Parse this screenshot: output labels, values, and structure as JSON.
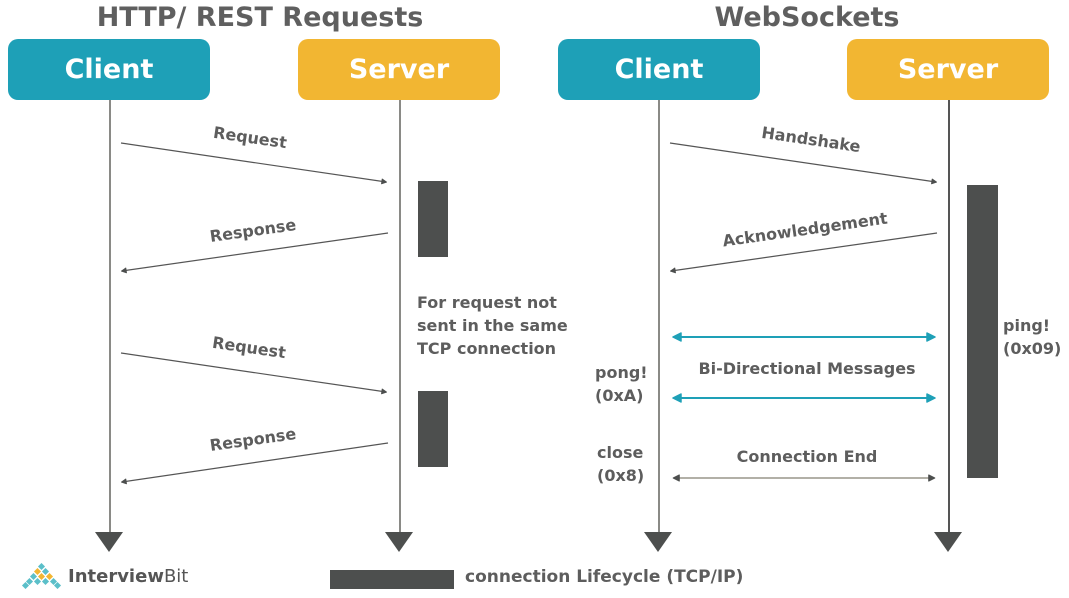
{
  "http_section": {
    "title": "HTTP/ REST Requests",
    "client_label": "Client",
    "server_label": "Server",
    "messages": [
      {
        "label": "Request",
        "direction": "client-to-server"
      },
      {
        "label": "Response",
        "direction": "server-to-client"
      },
      {
        "label": "Request",
        "direction": "client-to-server"
      },
      {
        "label": "Response",
        "direction": "server-to-client"
      }
    ],
    "note": [
      "For request not",
      "sent in the same",
      "TCP connection"
    ]
  },
  "websocket_section": {
    "title": "WebSockets",
    "client_label": "Client",
    "server_label": "Server",
    "messages": [
      {
        "label": "Handshake",
        "direction": "client-to-server"
      },
      {
        "label": "Acknowledgement",
        "direction": "server-to-client"
      },
      {
        "label": "Bi-Directional Messages",
        "direction": "both"
      },
      {
        "label": "Connection End",
        "direction": "both"
      }
    ],
    "ping_label": [
      "ping!",
      "(0x09)"
    ],
    "pong_label": [
      "pong!",
      "(0xA)"
    ],
    "close_label": [
      "close",
      "(0x8)"
    ]
  },
  "legend": {
    "text": "connection Lifecycle (TCP/IP)"
  },
  "logo": {
    "name_regular": "Interview",
    "name_suffix": "Bit"
  },
  "colors": {
    "client": "#1ea0b7",
    "server": "#f2b632",
    "bar": "#4d4f4e",
    "bidirectional_arrow": "#1ea0b7"
  }
}
